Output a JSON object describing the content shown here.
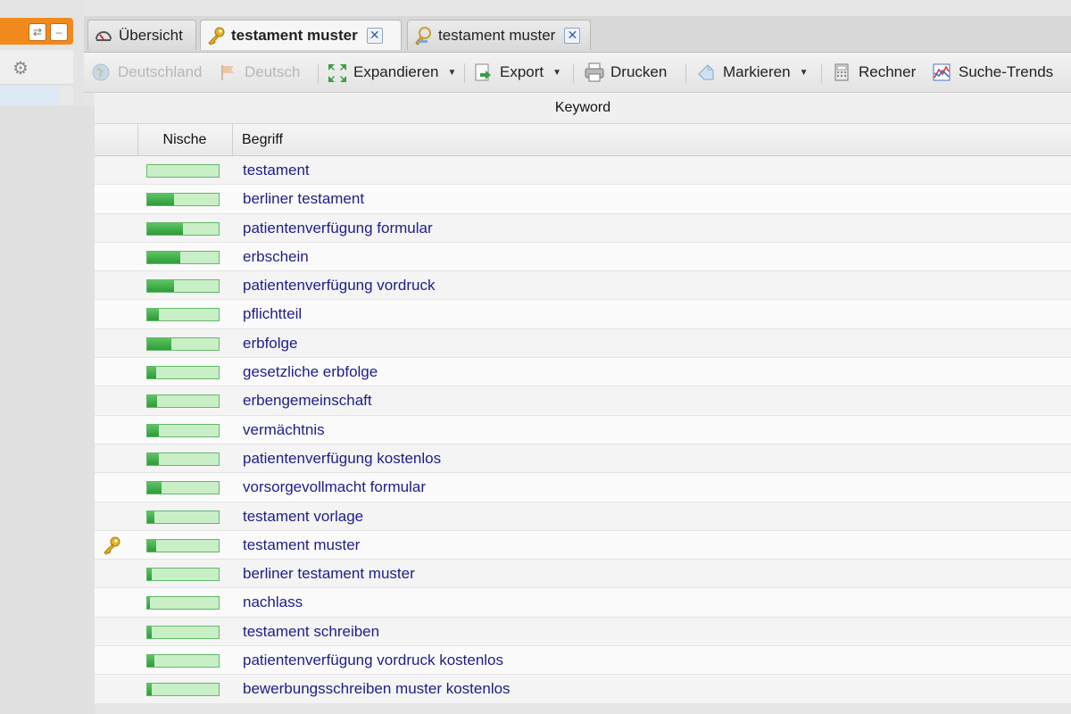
{
  "tabs": [
    {
      "label": "Übersicht",
      "icon": "gauge-icon"
    },
    {
      "label": "testament muster",
      "icon": "key-icon"
    },
    {
      "label": "testament muster",
      "icon": "key-search-icon"
    }
  ],
  "toolbar": {
    "country": "Deutschland",
    "language": "Deutsch",
    "expand": "Expandieren",
    "export": "Export",
    "print": "Drucken",
    "mark": "Markieren",
    "calculator": "Rechner",
    "trends": "Suche-Trends"
  },
  "table": {
    "group_header": "Keyword",
    "columns": [
      "Nische",
      "Begriff"
    ],
    "rows": [
      {
        "term": "testament",
        "niche": 0.0,
        "marked": false
      },
      {
        "term": "berliner testament",
        "niche": 0.38,
        "marked": false
      },
      {
        "term": "patientenverfügung formular",
        "niche": 0.5,
        "marked": false
      },
      {
        "term": "erbschein",
        "niche": 0.46,
        "marked": false
      },
      {
        "term": "patientenverfügung vordruck",
        "niche": 0.38,
        "marked": false
      },
      {
        "term": "pflichtteil",
        "niche": 0.16,
        "marked": false
      },
      {
        "term": "erbfolge",
        "niche": 0.34,
        "marked": false
      },
      {
        "term": "gesetzliche erbfolge",
        "niche": 0.12,
        "marked": false
      },
      {
        "term": "erbengemeinschaft",
        "niche": 0.14,
        "marked": false
      },
      {
        "term": "vermächtnis",
        "niche": 0.16,
        "marked": false
      },
      {
        "term": "patientenverfügung kostenlos",
        "niche": 0.16,
        "marked": false
      },
      {
        "term": "vorsorgevollmacht formular",
        "niche": 0.2,
        "marked": false
      },
      {
        "term": "testament vorlage",
        "niche": 0.1,
        "marked": false
      },
      {
        "term": "testament muster",
        "niche": 0.12,
        "marked": true
      },
      {
        "term": "berliner testament muster",
        "niche": 0.06,
        "marked": false
      },
      {
        "term": "nachlass",
        "niche": 0.04,
        "marked": false
      },
      {
        "term": "testament schreiben",
        "niche": 0.06,
        "marked": false
      },
      {
        "term": "patientenverfügung vordruck kostenlos",
        "niche": 0.1,
        "marked": false
      },
      {
        "term": "bewerbungsschreiben muster kostenlos",
        "niche": 0.06,
        "marked": false
      }
    ]
  },
  "colors": {
    "accent_orange": "#f08a1c",
    "link_blue": "#1d1d8a",
    "bar_green": "#3aab43",
    "bar_light": "#c9efc7"
  }
}
